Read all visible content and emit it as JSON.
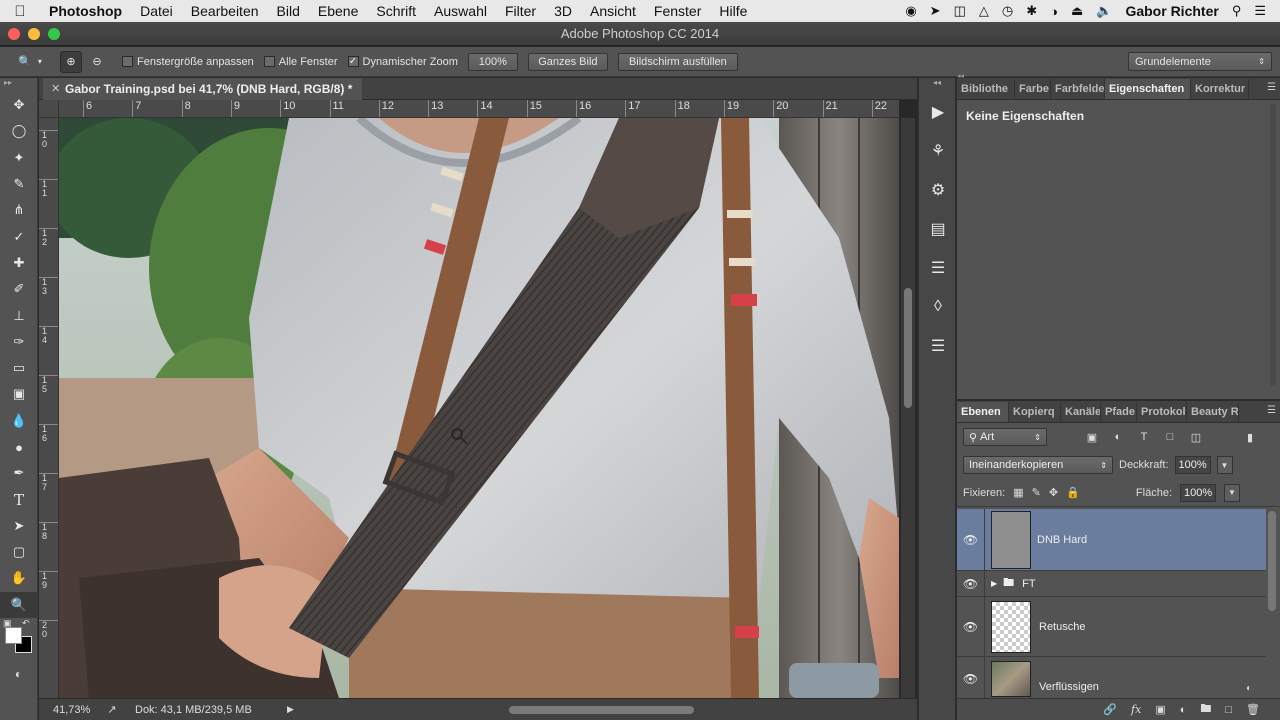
{
  "menubar": {
    "app": "Photoshop",
    "items": [
      "Datei",
      "Bearbeiten",
      "Bild",
      "Ebene",
      "Schrift",
      "Auswahl",
      "Filter",
      "3D",
      "Ansicht",
      "Fenster",
      "Hilfe"
    ],
    "user": "Gabor Richter"
  },
  "window": {
    "title": "Adobe Photoshop CC 2014"
  },
  "options": {
    "fit_window": "Fenstergröße anpassen",
    "all_windows": "Alle Fenster",
    "scrubby_zoom": "Dynamischer Zoom",
    "scrubby_zoom_checked": true,
    "btn_100": "100%",
    "btn_fit": "Ganzes Bild",
    "btn_fill": "Bildschirm ausfüllen",
    "workspace": "Grundelemente"
  },
  "document": {
    "tab_title": "Gabor Training.psd bei 41,7% (DNB Hard, RGB/8) *",
    "ruler_h": [
      "6",
      "7",
      "8",
      "9",
      "10",
      "11",
      "12",
      "13",
      "14",
      "15",
      "16",
      "17",
      "18",
      "19",
      "20",
      "21",
      "22"
    ],
    "ruler_v": [
      "10",
      "11",
      "12",
      "13",
      "14",
      "15",
      "16",
      "17",
      "18",
      "19",
      "20"
    ],
    "zoom": "41,73%",
    "doc_info": "Dok: 43,1 MB/239,5 MB"
  },
  "properties": {
    "tabs": [
      "Bibliothe",
      "Farbe",
      "Farbfelde",
      "Eigenschaften",
      "Korrektur"
    ],
    "active_tab": 3,
    "empty_text": "Keine Eigenschaften"
  },
  "layers_panel": {
    "tabs": [
      "Ebenen",
      "Kopierq",
      "Kanäle",
      "Pfade",
      "Protokol",
      "Beauty R"
    ],
    "active_tab": 0,
    "filter_kind": "Art",
    "blend_mode": "Ineinanderkopieren",
    "opacity_label": "Deckkraft:",
    "opacity": "100%",
    "lock_label": "Fixieren:",
    "fill_label": "Fläche:",
    "fill": "100%",
    "layers": [
      {
        "name": "DNB Hard",
        "selected": true
      },
      {
        "name": "FT",
        "group": true
      },
      {
        "name": "Retusche"
      },
      {
        "name": "Verflüssigen"
      }
    ]
  },
  "colors": {
    "selection_blue": "#6a7d9e",
    "panel_bg": "#535353"
  }
}
